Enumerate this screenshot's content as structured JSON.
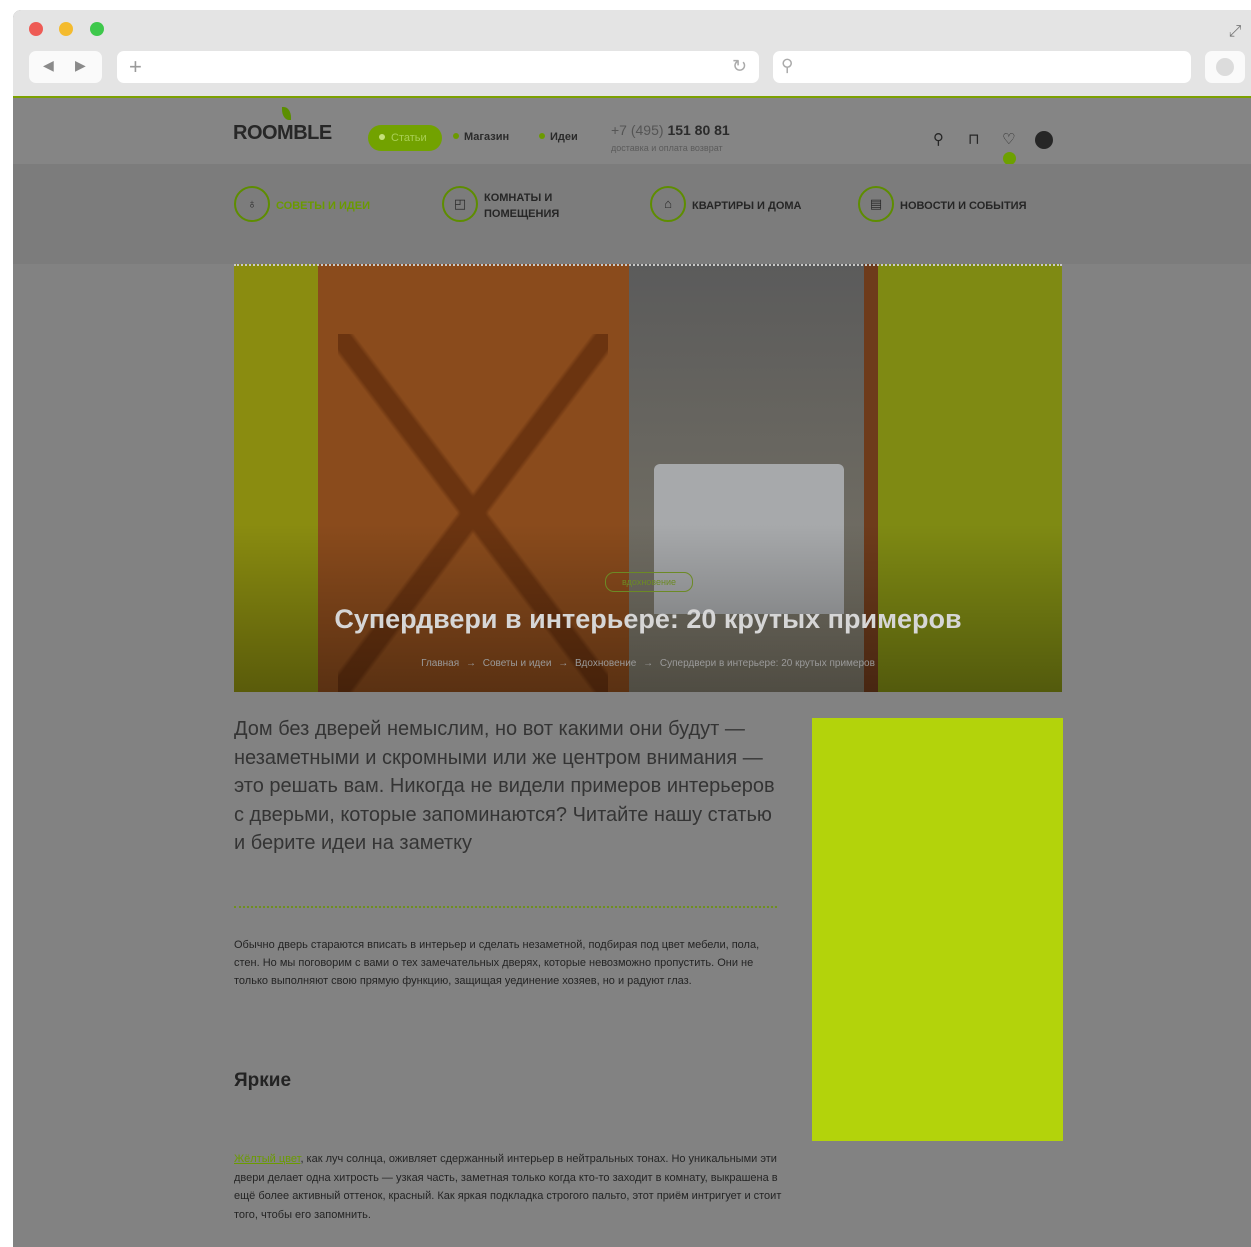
{
  "browser": {
    "new_tab_symbol": "+",
    "reload_symbol": "↻",
    "search_symbol": "⚲"
  },
  "site": {
    "logo": "ROOMBLE",
    "nav": {
      "active_pill": "Статьи",
      "shop": "Магазин",
      "ideas": "Идеи"
    },
    "phone": {
      "prefix": "+7 (495)",
      "number": "151 80 81",
      "subtitle": "доставка и оплата возврат"
    },
    "categories": [
      {
        "icon": "lightbulb-icon",
        "symbol": "♁",
        "label": "СОВЕТЫ И ИДЕИ"
      },
      {
        "icon": "room-icon",
        "symbol": "◰",
        "label": "КОМНАТЫ И ПОМЕЩЕНИЯ"
      },
      {
        "icon": "house-icon",
        "symbol": "⌂",
        "label": "КВАРТИРЫ И ДОМА"
      },
      {
        "icon": "news-icon",
        "symbol": "▤",
        "label": "НОВОСТИ И СОБЫТИЯ"
      }
    ],
    "accent_color": "#6b9b00"
  },
  "article": {
    "tag": "вдохновение",
    "title": "Супердвери в интерьере: 20 крутых примеров",
    "breadcrumbs": [
      "Главная",
      "Советы и идеи",
      "Вдохновение",
      "Супердвери в интерьере: 20 крутых примеров"
    ],
    "breadcrumb_sep": "→",
    "lead": "Дом без дверей немыслим, но вот какими они будут — незаметными и скромными или же центром внимания — это решать вам. Никогда не видели примеров интерьеров с дверьми, которые запоминаются? Читайте нашу статью и берите идеи на заметку",
    "paragraph1": "Обычно дверь стараются вписать в интерьер и сделать незаметной, подбирая под цвет мебели, пола, стен. Но мы поговорим с вами о тех замечательных дверях, которые невозможно пропустить. Они не только выполняют свою прямую функцию, защищая уединение хозяев, но и радуют глаз.",
    "heading": "Яркие",
    "paragraph2_link": "Жёлтый цвет",
    "paragraph2_text": ", как луч солнца, оживляет сдержанный интерьер в нейтральных тонах. Но уникальными эти двери делает одна хитрость — узкая часть, заметная только когда кто-то заходит в комнату, выкрашена в ещё более активный оттенок, красный. Как яркая подкладка строгого пальто, этот приём интригует и стоит того, чтобы его запомнить."
  },
  "ad": {
    "color": "#b3d30b"
  }
}
